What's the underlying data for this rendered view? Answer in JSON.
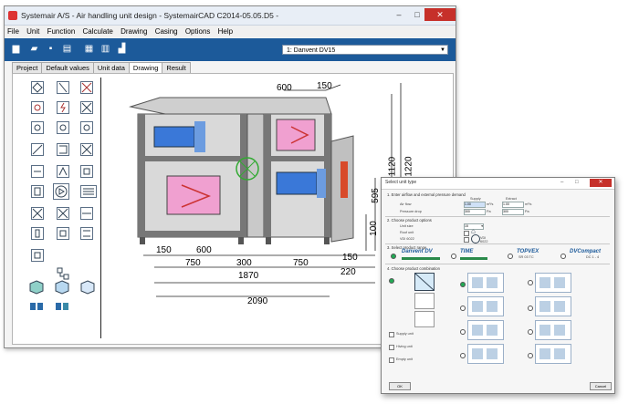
{
  "window": {
    "title": "Systemair A/S - Air handling unit design - SystemairCAD C2014-05.05.D5 -",
    "controls": {
      "minimize": "–",
      "maximize": "□",
      "close": "✕"
    }
  },
  "menu": [
    "File",
    "Unit",
    "Function",
    "Calculate",
    "Drawing",
    "Casing",
    "Options",
    "Help"
  ],
  "toolbar": {
    "icons": [
      "new-icon",
      "open-icon",
      "save-icon",
      "print-icon",
      "calculator-grid-icon",
      "calculator-icon",
      "chart-icon"
    ],
    "project_select": "1:  Danvent DV15"
  },
  "tabs": [
    {
      "label": "Project",
      "active": false
    },
    {
      "label": "Default values",
      "active": false
    },
    {
      "label": "Unit data",
      "active": false
    },
    {
      "label": "Drawing",
      "active": true
    },
    {
      "label": "Result",
      "active": false
    }
  ],
  "drawing": {
    "dims": {
      "top_width": "600",
      "top_offset": "150",
      "right_1120": "1120",
      "right_1220": "1220",
      "right_595": "595",
      "right_100": "100",
      "b1_150": "150",
      "b1_600": "600",
      "b2_750": "750",
      "b2_300": "300",
      "b2_750b": "750",
      "b2_150": "150",
      "b3_1870": "1870",
      "b3_220": "220",
      "b4_2090": "2090"
    }
  },
  "dialog": {
    "title": "Select unit type",
    "s1": {
      "heading": "1. Enter airflow and external pressure demand",
      "col_supply": "Supply",
      "col_extract": "Extract",
      "airflow_label": "Air flow",
      "pressure_label": "Pressure drop",
      "supply_airflow": "1.00",
      "supply_airflow_unit": "m³/s",
      "supply_pressure": "300",
      "supply_pressure_unit": "Pa",
      "extract_airflow": "1.00",
      "extract_airflow_unit": "m³/s",
      "extract_pressure": "300",
      "extract_pressure_unit": "Pa"
    },
    "s2": {
      "heading": "2. Choose product options",
      "unit_size_label": "Unit size",
      "unit_size_value": "15",
      "roof_label": "Roof unit",
      "vdi_label": "VDI 6022",
      "vdi_badge": "VDI 6022"
    },
    "s3": {
      "heading": "3. Select product range",
      "products": [
        {
          "name": "Danvent DV",
          "note": ""
        },
        {
          "name": "TIME",
          "note": ""
        },
        {
          "name": "TOPVEX",
          "note": "SR 03 TC"
        },
        {
          "name": "DVCompact",
          "note": "DC 1 - 4"
        }
      ]
    },
    "s4": {
      "heading": "4. Choose product combination",
      "options": [
        "Supply unit",
        "Hiving unit",
        "Empty unit"
      ]
    },
    "ok_label": "OK",
    "cancel_label": "Cancel"
  }
}
